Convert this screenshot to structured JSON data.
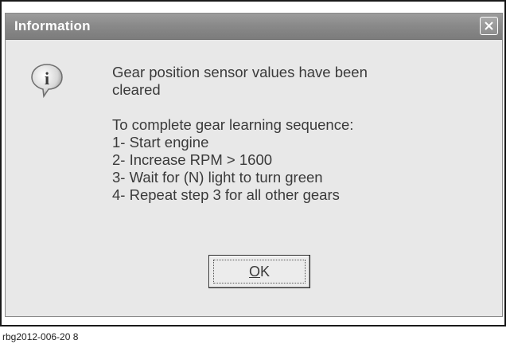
{
  "window": {
    "title": "Information",
    "close_glyph": "✕"
  },
  "icon": {
    "name": "information-icon",
    "glyph": "i"
  },
  "message": {
    "lines": [
      "Gear position sensor values have been",
      "cleared",
      "",
      "To complete gear learning sequence:",
      "1- Start engine",
      "2- Increase RPM > 1600",
      "3- Wait for (N) light to turn green",
      "4- Repeat step 3 for all other gears"
    ]
  },
  "buttons": {
    "ok_mnemonic": "O",
    "ok_rest": "K"
  },
  "caption": "rbg2012-006-20 8"
}
